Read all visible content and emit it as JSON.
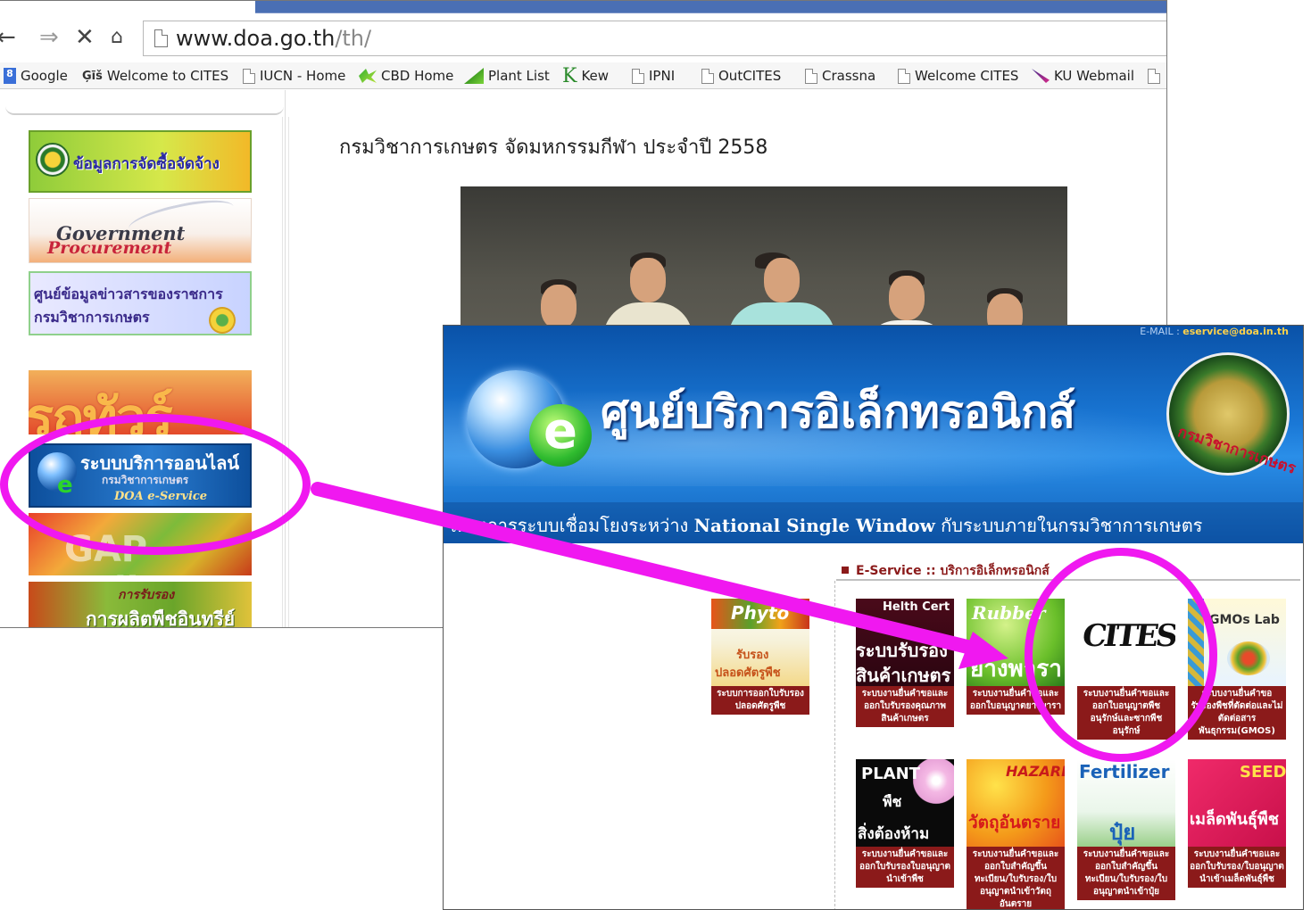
{
  "browser": {
    "nav": {
      "back": "←",
      "forward": "⇒",
      "stop": "✕",
      "home": "🏠"
    },
    "url_host": "www.doa.go.th",
    "url_path": "/th/"
  },
  "bookmarks": [
    {
      "label": "Google",
      "icon": "google-icon"
    },
    {
      "label": "Welcome to CITES",
      "icon": "cites-icon",
      "glyph": "Ģīš"
    },
    {
      "label": "IUCN - Home",
      "icon": "page-icon"
    },
    {
      "label": "CBD Home",
      "icon": "cbd-leaf-icon"
    },
    {
      "label": "Plant List",
      "icon": "plantlist-icon"
    },
    {
      "label": "Kew",
      "icon": "kew-icon",
      "glyph": "K"
    },
    {
      "label": "IPNI",
      "icon": "page-icon"
    },
    {
      "label": "OutCITES",
      "icon": "page-icon"
    },
    {
      "label": "Crassna",
      "icon": "page-icon"
    },
    {
      "label": "Welcome CITES",
      "icon": "page-icon"
    },
    {
      "label": "KU Webmail",
      "icon": "ku-icon"
    }
  ],
  "sidebar": {
    "banner1": "ข้อมูลการจัดซื้อจัดจ้าง",
    "banner2": {
      "line1": "Government",
      "line2": "Procurement"
    },
    "banner3": {
      "line1": "ศูนย์ข้อมูลข่าวสารของราชการ",
      "line2": "กรมวิชาการเกษตร"
    },
    "banner4": "รถทัวร์",
    "banner5": {
      "line1": "ระบบบริการออนไลน์",
      "line2": "กรมวิชาการเกษตร",
      "line3": "DOA e-Service"
    },
    "banner6": "GAP online",
    "banner7": {
      "line1": "การรับรอง",
      "line2": "การผลิตพืชอินทรีย์"
    }
  },
  "main": {
    "news_title": "กรมวิชาการเกษตร จัดมหกรรมกีฬา ประจำปี 2558"
  },
  "eservice": {
    "email_label": "E-MAIL :",
    "email_value": "eservice@doa.in.th",
    "header_title": "ศูนย์บริการอิเล็กทรอนิกส์",
    "emblem_text": "กรมวิชาการเกษตร",
    "subtitle_pre": "โครงการระบบเชื่อมโยงระหว่าง",
    "subtitle_bold": "National Single Window",
    "subtitle_post": "กับระบบภายในกรมวิชาการเกษตร",
    "section_label": "E-Service :: บริการอิเล็กทรอนิกส์",
    "tiles": [
      {
        "key": "phyto",
        "img_text": "Phyto",
        "img_sub1": "รับรอง",
        "img_sub2": "ปลอดศัตรูพืช",
        "caption": "ระบบการออกใบรับรองปลอดศัตรูพืช"
      },
      {
        "key": "health",
        "img_text": "Helth Cert",
        "img_sub1": "ระบบรับรอง",
        "img_sub2": "สินค้าเกษตร",
        "caption": "ระบบงานยื่นคำขอและออกใบรับรองคุณภาพสินค้าเกษตร"
      },
      {
        "key": "rubber",
        "img_text": "Rubber",
        "img_sub1": "ยางพารา",
        "caption": "ระบบงานยื่นคำขอและออกใบอนุญาตยางพารา"
      },
      {
        "key": "cites",
        "img_text": "CITES",
        "caption": "ระบบงานยื่นคำขอและออกใบอนุญาตพืชอนุรักษ์และซากพืชอนุรักษ์"
      },
      {
        "key": "gmos",
        "img_text": "GMOs Lab",
        "caption": "ระบบงานยื่นคำขอรับรองพืชที่ตัดต่อและไม่ตัดต่อสารพันธุกรรม(GMOS)"
      },
      {
        "key": "plant",
        "img_text": "PLANT",
        "img_sub1": "พืช",
        "img_sub2": "สิ่งต้องห้าม",
        "caption": "ระบบงานยื่นคำขอและออกใบรับรองใบอนุญาตนำเข้าพืช"
      },
      {
        "key": "hazard",
        "img_text": "HAZARD",
        "img_sub1": "วัตถุอันตราย",
        "caption": "ระบบงานยื่นคำขอและออกใบสำคัญขึ้นทะเบียน/ใบรับรอง/ใบอนุญาตนำเข้าวัตถุอันตราย"
      },
      {
        "key": "fertilizer",
        "img_text": "Fertilizer",
        "img_sub1": "ปุ๋ย",
        "caption": "ระบบงานยื่นคำขอและออกใบสำคัญขึ้นทะเบียน/ใบรับรอง/ใบอนุญาตนำเข้าปุ๋ย"
      },
      {
        "key": "seed",
        "img_text": "SEED",
        "img_sub1": "เมล็ดพันธุ์พืช",
        "caption": "ระบบงานยื่นคำขอและออกใบรับรอง/ใบอนุญาตนำเข้าเมล็ดพันธุ์พืช"
      }
    ]
  },
  "colors": {
    "annotation": "#f018f0",
    "tile_caption": "#8b1a1a",
    "header_blue": "#1a78d6"
  }
}
